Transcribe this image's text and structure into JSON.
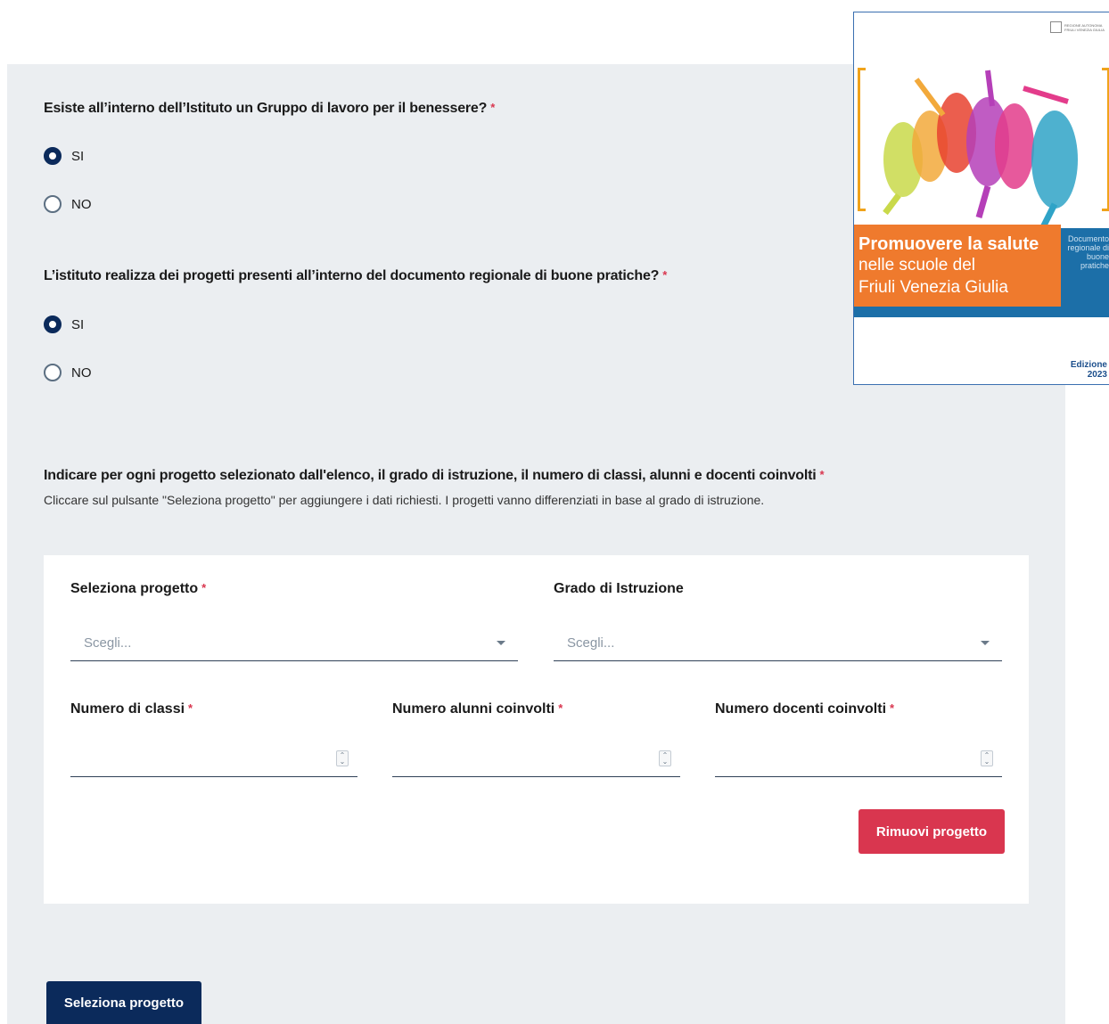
{
  "form": {
    "q1": {
      "title": "Esiste all’interno dell’Istituto un Gruppo di lavoro per il benessere?",
      "required_mark": "*",
      "options": [
        {
          "label": "SI",
          "checked": true
        },
        {
          "label": "NO",
          "checked": false
        }
      ]
    },
    "q2": {
      "title": "L’istituto realizza dei progetti presenti all’interno del documento regionale di buone pratiche?",
      "required_mark": "*",
      "options": [
        {
          "label": "SI",
          "checked": true
        },
        {
          "label": "NO",
          "checked": false
        }
      ]
    },
    "q3": {
      "title": "Indicare per ogni progetto selezionato dall'elenco, il grado di istruzione, il numero di classi, alunni e docenti coinvolti",
      "required_mark": "*",
      "hint": "Cliccare sul pulsante \"Seleziona progetto\" per aggiungere i dati richiesti. I progetti vanno differenziati in base al grado di istruzione."
    },
    "project_card": {
      "seleziona_progetto": {
        "label": "Seleziona progetto",
        "required_mark": "*",
        "placeholder": "Scegli..."
      },
      "grado_istruzione": {
        "label": "Grado di Istruzione",
        "placeholder": "Scegli..."
      },
      "numero_classi": {
        "label": "Numero di classi",
        "required_mark": "*",
        "value": ""
      },
      "numero_alunni": {
        "label": "Numero alunni coinvolti",
        "required_mark": "*",
        "value": ""
      },
      "numero_docenti": {
        "label": "Numero docenti coinvolti",
        "required_mark": "*",
        "value": ""
      },
      "remove_button": "Rimuovi progetto"
    },
    "add_button": "Seleziona progetto"
  },
  "brochure": {
    "title_line1": "Promuovere la salute",
    "title_line2": "nelle scuole del",
    "title_line3": "Friuli Venezia Giulia",
    "side_text": "Documento regionale di buone pratiche",
    "edition_line1": "Edizione",
    "edition_line2": "2023",
    "logo_text": "REGIONE AUTONOMA FRIULI VENEZIA GIULIA"
  },
  "colors": {
    "primary": "#0b2a5b",
    "danger": "#d9364f",
    "panel_bg": "#ebeef1",
    "brochure_orange": "#ef7a2d",
    "brochure_blue": "#1c6fa8"
  }
}
